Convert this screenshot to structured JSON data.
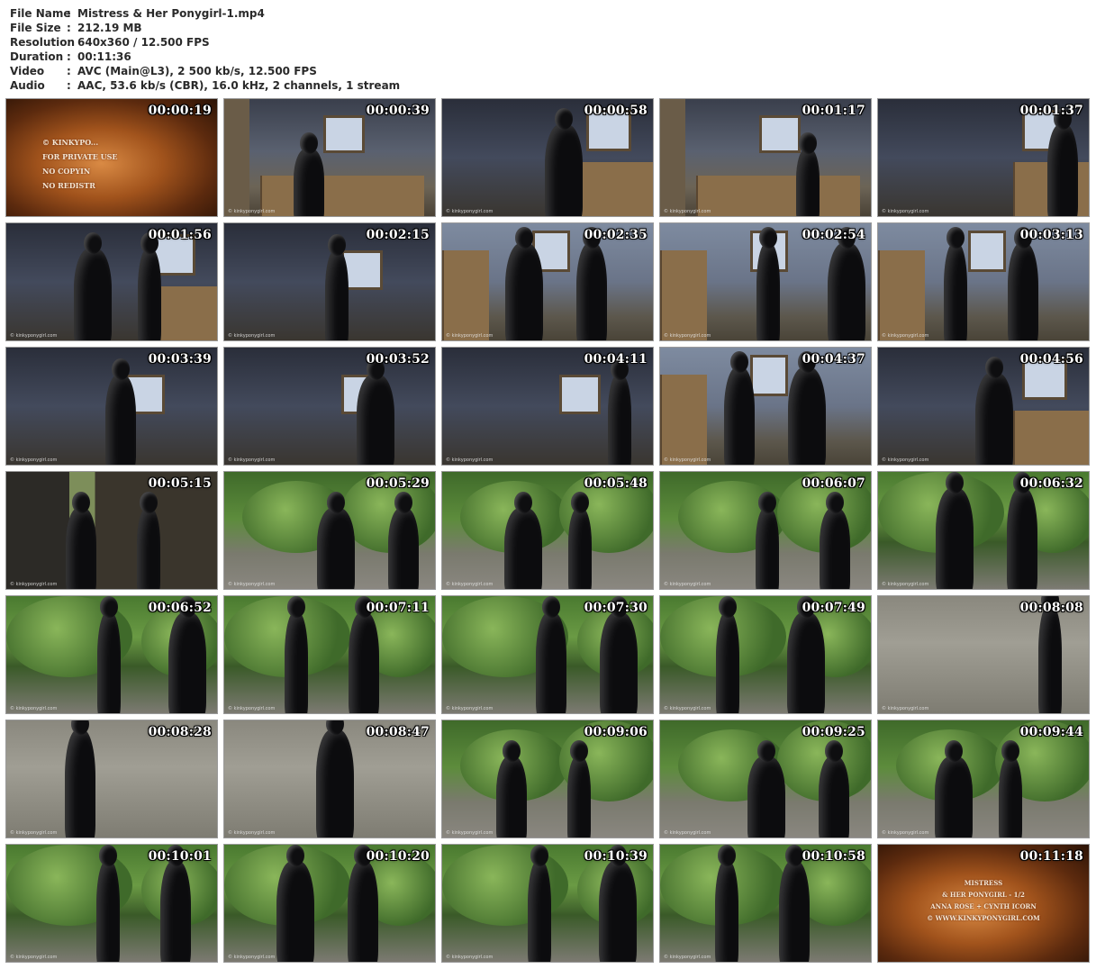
{
  "info": [
    {
      "key": "File Name",
      "sep": ":",
      "value": "Mistress & Her Ponygirl-1.mp4"
    },
    {
      "key": "File Size",
      "sep": ":",
      "value": "212.19 MB"
    },
    {
      "key": "Resolution",
      "sep": ":",
      "value": "640x360 / 12.500 FPS"
    },
    {
      "key": "Duration",
      "sep": ":",
      "value": "00:11:36"
    },
    {
      "key": "Video",
      "sep": ":",
      "value": "AVC (Main@L3), 2 500 kb/s, 12.500 FPS"
    },
    {
      "key": "Audio",
      "sep": ":",
      "value": "AAC, 53.6 kb/s (CBR), 16.0 kHz, 2 channels, 1 stream"
    }
  ],
  "watermark": "© kinkyponygirl.com",
  "title_card_start": "© KINKYPO...\nFOR PRIVATE USE\nNO COPYIN\nNO REDISTR",
  "title_card_end": "MISTRESS\n& HER PONYGIRL - 1/2\nANNA ROSE + CYNTH ICORN\n© WWW.KINKYPONYGIRL.COM",
  "thumbnails": [
    {
      "time": "00:00:19",
      "scene": "card-start"
    },
    {
      "time": "00:00:39",
      "scene": "barn-window"
    },
    {
      "time": "00:00:58",
      "scene": "barn-dark"
    },
    {
      "time": "00:01:17",
      "scene": "barn-window"
    },
    {
      "time": "00:01:37",
      "scene": "barn-dark"
    },
    {
      "time": "00:01:56",
      "scene": "barn-dark"
    },
    {
      "time": "00:02:15",
      "scene": "closeup"
    },
    {
      "time": "00:02:35",
      "scene": "room"
    },
    {
      "time": "00:02:54",
      "scene": "room"
    },
    {
      "time": "00:03:13",
      "scene": "room"
    },
    {
      "time": "00:03:39",
      "scene": "closeup"
    },
    {
      "time": "00:03:52",
      "scene": "closeup"
    },
    {
      "time": "00:04:11",
      "scene": "closeup"
    },
    {
      "time": "00:04:37",
      "scene": "room"
    },
    {
      "time": "00:04:56",
      "scene": "barn-dark"
    },
    {
      "time": "00:05:15",
      "scene": "door"
    },
    {
      "time": "00:05:29",
      "scene": "yard"
    },
    {
      "time": "00:05:48",
      "scene": "yard"
    },
    {
      "time": "00:06:07",
      "scene": "yard"
    },
    {
      "time": "00:06:32",
      "scene": "yard-close"
    },
    {
      "time": "00:06:52",
      "scene": "yard-close"
    },
    {
      "time": "00:07:11",
      "scene": "yard-close"
    },
    {
      "time": "00:07:30",
      "scene": "yard-close"
    },
    {
      "time": "00:07:49",
      "scene": "yard-close"
    },
    {
      "time": "00:08:08",
      "scene": "ground"
    },
    {
      "time": "00:08:28",
      "scene": "ground"
    },
    {
      "time": "00:08:47",
      "scene": "ground"
    },
    {
      "time": "00:09:06",
      "scene": "yard"
    },
    {
      "time": "00:09:25",
      "scene": "yard"
    },
    {
      "time": "00:09:44",
      "scene": "yard"
    },
    {
      "time": "00:10:01",
      "scene": "yard-close"
    },
    {
      "time": "00:10:20",
      "scene": "yard-close"
    },
    {
      "time": "00:10:39",
      "scene": "yard-close"
    },
    {
      "time": "00:10:58",
      "scene": "yard-close"
    },
    {
      "time": "00:11:18",
      "scene": "card-end"
    }
  ]
}
